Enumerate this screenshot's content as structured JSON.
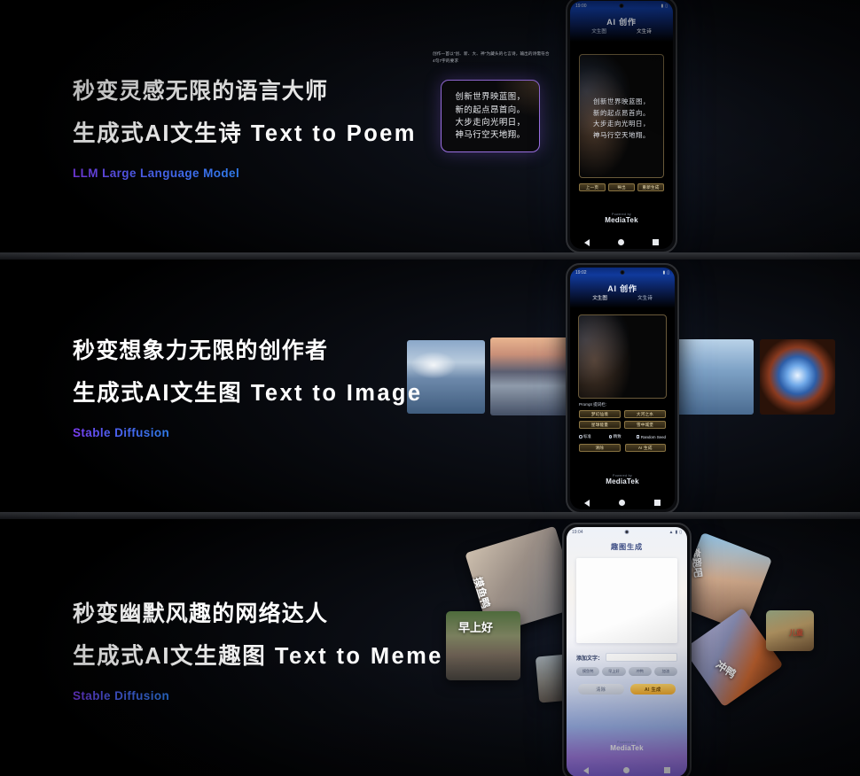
{
  "sections": [
    {
      "id": "text-to-poem",
      "headline": "秒变灵感无限的语言大师",
      "subheadline_cn": "生成式AI文生诗",
      "subheadline_en": "Text to Poem",
      "model_label": "LLM Large Language Model",
      "callout": {
        "caption": "创作一首以\"创、新、大、神\"为藏头的七言诗，输出的诗需符合4句7字的要求",
        "lines": [
          "创新世界映蓝图，",
          "新的起点昂首向。",
          "大步走向光明日，",
          "神马行空天地翔。"
        ]
      },
      "phone": {
        "status_time": "19:00",
        "app_title": "AI 创作",
        "tabs": [
          {
            "label": "文生图",
            "active": false
          },
          {
            "label": "文生诗",
            "active": true
          }
        ],
        "poem_lines": [
          "创新世界映蓝图，",
          "新的起点昂首向。",
          "大步走向光明日，",
          "神马行空天地翔。"
        ],
        "buttons": [
          "上一页",
          "导出",
          "重新生成"
        ],
        "powered_by": "Powered by",
        "brand": "MediaTek"
      }
    },
    {
      "id": "text-to-image",
      "headline": "秒变想象力无限的创作者",
      "subheadline_cn": "生成式AI文生图",
      "subheadline_en": "Text to Image",
      "model_label": "Stable Diffusion",
      "phone": {
        "status_time": "19:02",
        "app_title": "AI 创作",
        "tabs": [
          {
            "label": "文生图",
            "active": true
          },
          {
            "label": "文生诗",
            "active": false
          }
        ],
        "prompt_label": "Prompt 提词栏:",
        "presets": [
          "梦幻仙境",
          "大河之水",
          "星球能量",
          "雪中城堡"
        ],
        "quality_options": [
          {
            "label": "标准",
            "selected": false
          },
          {
            "label": "精致",
            "selected": true
          }
        ],
        "random_seed_label": "Random Seed",
        "random_seed_checked": false,
        "buttons": [
          "清除",
          "AI 生成"
        ],
        "powered_by": "Powered by",
        "brand": "MediaTek"
      },
      "samples": [
        {
          "name": "clouds-over-water",
          "alt": "蓝天白云湖面"
        },
        {
          "name": "sunset-mountain-lake",
          "alt": "日落山湖倒影"
        },
        {
          "name": "misty-river-valley",
          "alt": "云雾河谷"
        },
        {
          "name": "snow-rock-stream",
          "alt": "雪岩溪流"
        },
        {
          "name": "cosmic-vortex",
          "alt": "宇宙漩涡"
        }
      ]
    },
    {
      "id": "text-to-meme",
      "headline": "秒变幽默风趣的网络达人",
      "subheadline_cn": "生成式AI文生趣图",
      "subheadline_en": "Text to Meme",
      "model_label": "Stable Diffusion",
      "phone": {
        "status_time": "19:04",
        "app_title": "趣图生成",
        "add_text_label": "添加文字：",
        "add_text_value": "",
        "chips": [
          "摸鱼鸭",
          "早上好",
          "冲鸭",
          "加油"
        ],
        "buttons": [
          "清除",
          "AI 生成"
        ],
        "powered_by": "Powered by",
        "brand": "MediaTek"
      },
      "cards": [
        {
          "name": "duck-card",
          "caption": "摸鱼鸭"
        },
        {
          "name": "bowl-card",
          "caption": "早上好"
        },
        {
          "name": "goose-card",
          "caption": ""
        },
        {
          "name": "dog-card",
          "caption": "奔跑吧"
        },
        {
          "name": "carrot-card",
          "caption": "冲鸭"
        },
        {
          "name": "small-card",
          "caption": "儿童"
        }
      ]
    }
  ],
  "colors": {
    "accent_purple": "#7b3cf0",
    "accent_blue": "#2f7ae8",
    "gold": "#f0a92e",
    "background": "#000000"
  }
}
